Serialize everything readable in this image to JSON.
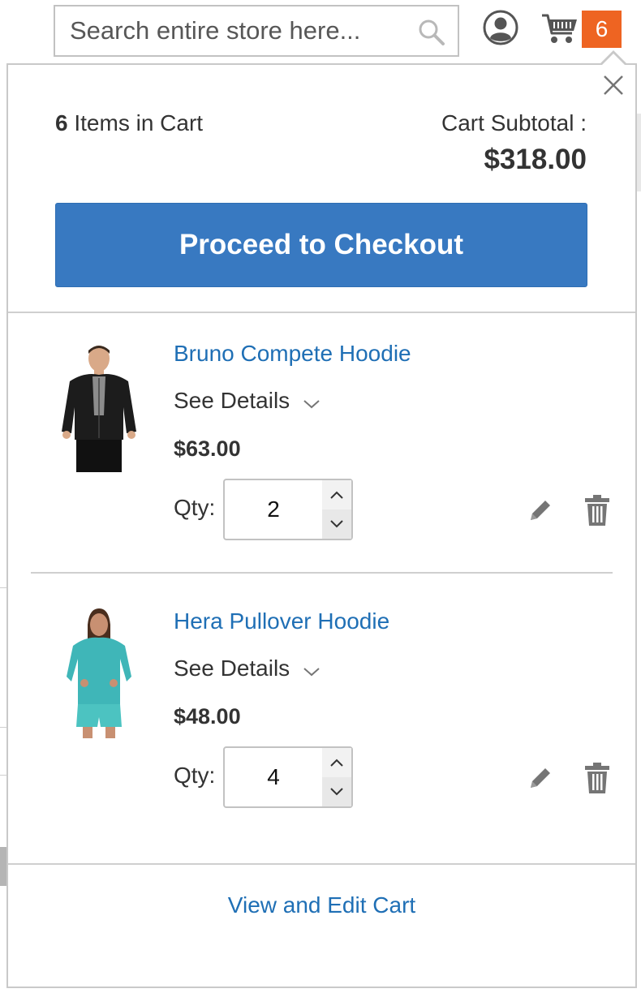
{
  "header": {
    "search": {
      "placeholder": "Search entire store here...",
      "value": ""
    },
    "cart_count": "6",
    "icons": {
      "search": "search-icon",
      "account": "account-icon",
      "cart": "cart-icon"
    }
  },
  "minicart": {
    "items_count": "6",
    "items_label": "Items in Cart",
    "subtotal_label": "Cart Subtotal :",
    "subtotal_amount": "$318.00",
    "checkout_label": "Proceed to Checkout",
    "view_cart_label": "View and Edit Cart",
    "products": [
      {
        "name": "Bruno Compete Hoodie",
        "details_label": "See Details",
        "price": "$63.00",
        "qty_label": "Qty:",
        "qty": "2"
      },
      {
        "name": "Hera Pullover Hoodie",
        "details_label": "See Details",
        "price": "$48.00",
        "qty_label": "Qty:",
        "qty": "4"
      }
    ]
  },
  "colors": {
    "accent": "#3879c1",
    "link": "#1f6fb5",
    "badge": "#ee6422",
    "border": "#c9c9c9"
  }
}
